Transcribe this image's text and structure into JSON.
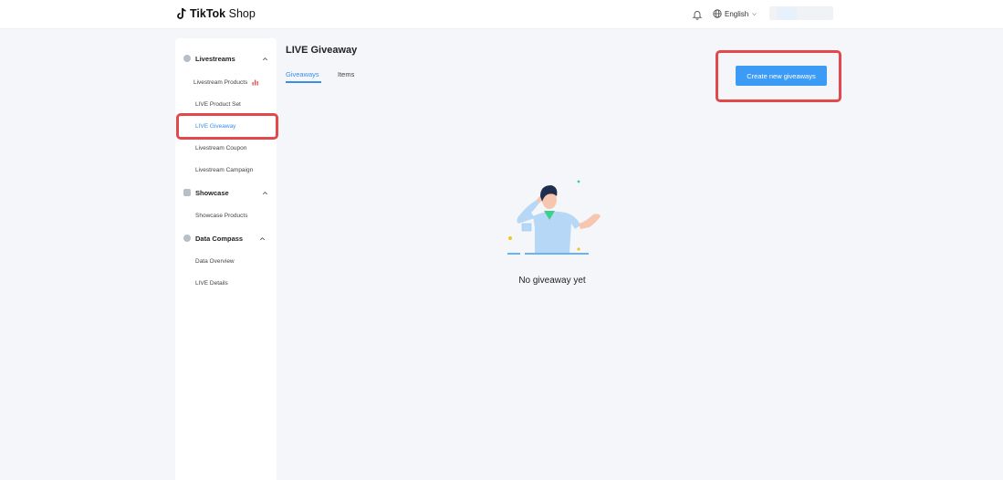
{
  "header": {
    "brand_bold": "TikTok",
    "brand_light": "Shop",
    "language": "English"
  },
  "sidebar": {
    "sections": [
      {
        "label": "Livestreams",
        "items": [
          {
            "label": "Livestream Products"
          },
          {
            "label": "LIVE Product Set"
          },
          {
            "label": "LIVE Giveaway"
          },
          {
            "label": "Livestream Coupon"
          },
          {
            "label": "Livestream Campaign"
          }
        ]
      },
      {
        "label": "Showcase",
        "items": [
          {
            "label": "Showcase Products"
          }
        ]
      },
      {
        "label": "Data Compass",
        "items": [
          {
            "label": "Data Overview"
          },
          {
            "label": "LIVE Details"
          }
        ]
      }
    ],
    "active_item": "LIVE Giveaway"
  },
  "main": {
    "title": "LIVE Giveaway",
    "tabs": [
      {
        "label": "Giveaways"
      },
      {
        "label": "Items"
      }
    ],
    "active_tab": "Giveaways",
    "create_button": "Create new giveaways",
    "empty_state": "No giveaway yet"
  },
  "colors": {
    "accent": "#3b9bf5",
    "highlight": "#e3494a",
    "background": "#f4f6fa"
  }
}
